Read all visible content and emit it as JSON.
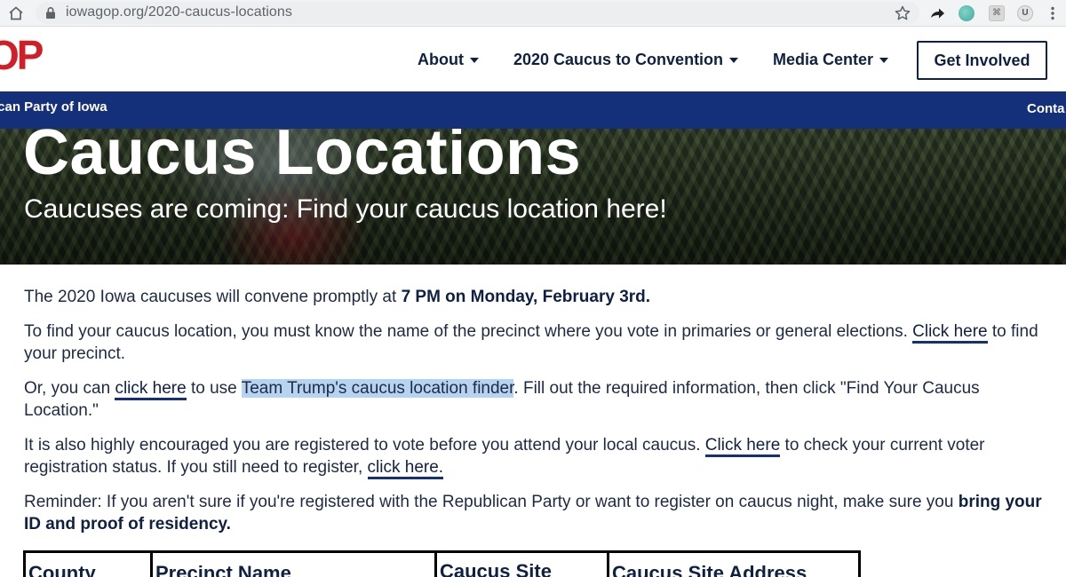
{
  "browser": {
    "url": "iowagop.org/2020-caucus-locations",
    "icons": [
      "home-icon",
      "lock-icon",
      "star-icon",
      "share-extension-icon",
      "circle-extension-icon",
      "box-extension-icon",
      "u-extension-icon",
      "kebab-menu-icon"
    ]
  },
  "header": {
    "logo_text": "OP",
    "nav": {
      "about": "About",
      "caucus": "2020 Caucus to Convention",
      "media": "Media Center"
    },
    "cta_label": "Get Involved"
  },
  "party_bar": {
    "name": "ican Party of Iowa",
    "contact": "Conta"
  },
  "hero": {
    "title": "Caucus Locations",
    "subtitle": "Caucuses are coming: Find your caucus location here!"
  },
  "content": {
    "p1": {
      "text": "The 2020 Iowa caucuses will convene promptly at ",
      "bold": "7 PM on Monday, February 3rd."
    },
    "p2": {
      "before": "To find your caucus location, you must know the name of the precinct where you vote in primaries or general elections. ",
      "link": "Click here",
      "after": " to find your precinct."
    },
    "p3": {
      "before": "Or, you can ",
      "link": "click here",
      "middle": " to use ",
      "highlight": "Team Trump's caucus location finder",
      "after": ". Fill out the required information, then click \"Find Your Caucus Location.\""
    },
    "p4": {
      "before": "It is also highly encouraged you are registered to vote before you attend your local caucus. ",
      "link1": "Click here",
      "middle": " to check your current voter registration status. If you still need to register, ",
      "link2": "click here."
    },
    "p5": {
      "before": "Reminder: If you aren't sure if you're registered with the Republican Party or want to register on caucus night, make sure you ",
      "bold": "bring your ID and proof of residency."
    }
  },
  "table": {
    "headers": [
      "County",
      "Precinct Name",
      "Caucus Site",
      "Caucus Site Address"
    ]
  },
  "colors": {
    "navy": "#0f2142",
    "party_bar": "#15307a",
    "logo_red": "#d21f26",
    "highlight": "#b7d3f2"
  }
}
